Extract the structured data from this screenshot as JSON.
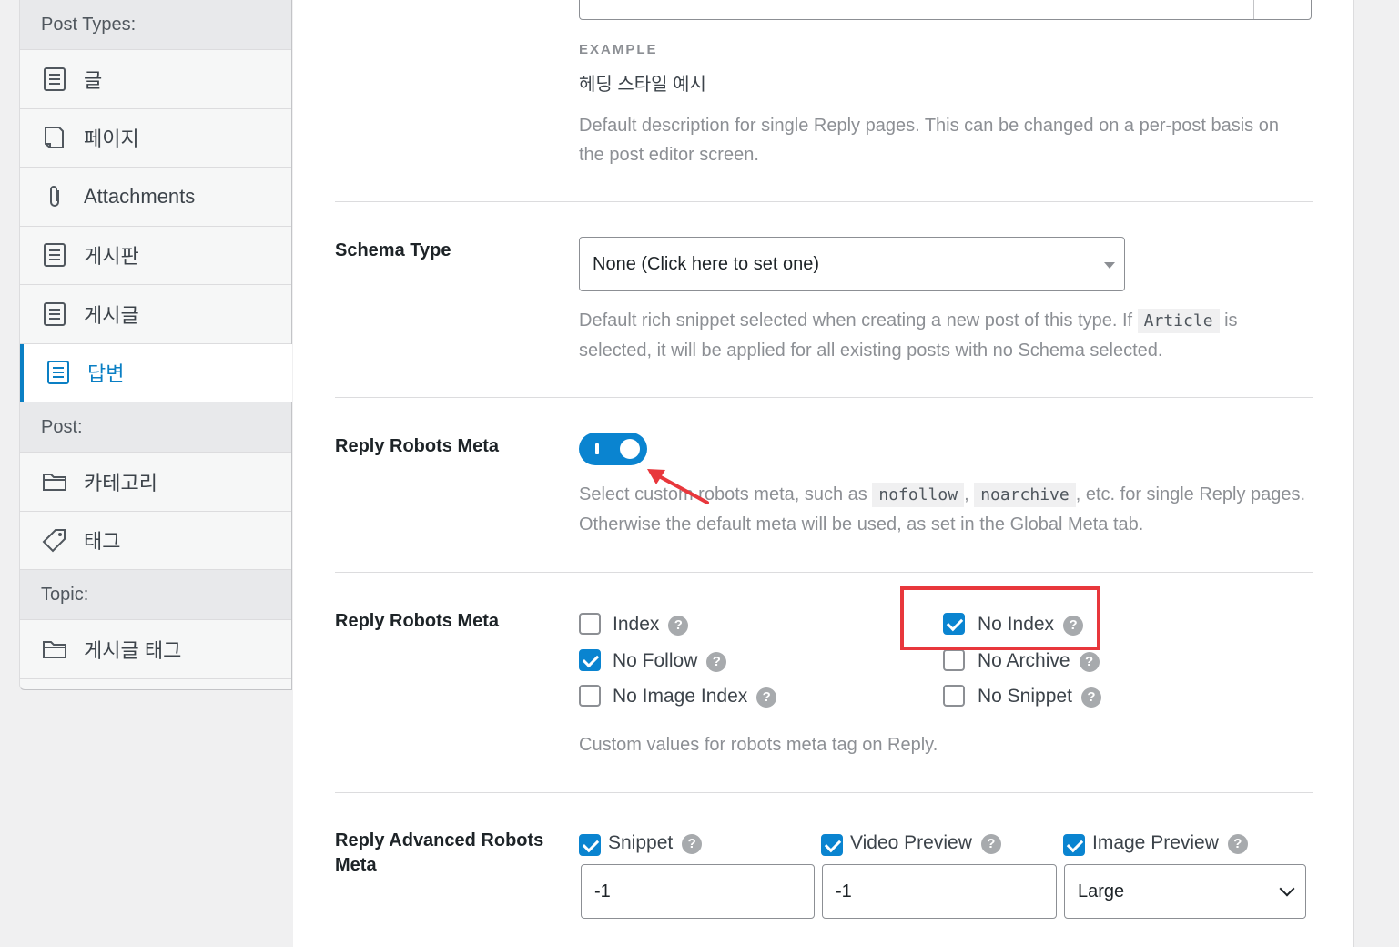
{
  "sidebar": {
    "post_types_heading": "Post Types:",
    "post_types": [
      {
        "label": "글",
        "icon": "document-icon"
      },
      {
        "label": "페이지",
        "icon": "page-icon"
      },
      {
        "label": "Attachments",
        "icon": "paperclip-icon"
      },
      {
        "label": "게시판",
        "icon": "document-icon"
      },
      {
        "label": "게시글",
        "icon": "document-icon"
      },
      {
        "label": "답변",
        "icon": "document-icon",
        "active": true
      }
    ],
    "post_heading": "Post:",
    "post_items": [
      {
        "label": "카테고리",
        "icon": "folder-icon"
      },
      {
        "label": "태그",
        "icon": "tag-icon"
      }
    ],
    "topic_heading": "Topic:",
    "topic_items": [
      {
        "label": "게시글 태그",
        "icon": "folder-icon"
      }
    ]
  },
  "description_field": {
    "example_heading": "EXAMPLE",
    "example_text": "헤딩 스타일 예시",
    "help": "Default description for single Reply pages. This can be changed on a per-post basis on the post editor screen."
  },
  "schema_type": {
    "label": "Schema Type",
    "selected": "None (Click here to set one)",
    "help_before": "Default rich snippet selected when creating a new post of this type. If ",
    "help_code": "Article",
    "help_after": " is selected, it will be applied for all existing posts with no Schema selected."
  },
  "robots_toggle": {
    "label": "Reply Robots Meta",
    "enabled": true,
    "help_1": "Select custom robots meta, such as ",
    "code_1": "nofollow",
    "sep": ",",
    "code_2": "noarchive",
    "help_2": ", etc. for single Reply pages. Otherwise the default meta will be used, as set in the Global Meta tab."
  },
  "robots_meta": {
    "label": "Reply Robots Meta",
    "options": [
      {
        "label": "Index",
        "checked": false
      },
      {
        "label": "No Index",
        "checked": true
      },
      {
        "label": "No Follow",
        "checked": true
      },
      {
        "label": "No Archive",
        "checked": false
      },
      {
        "label": "No Image Index",
        "checked": false
      },
      {
        "label": "No Snippet",
        "checked": false
      }
    ],
    "help": "Custom values for robots meta tag on Reply.",
    "help_glyph": "?"
  },
  "advanced_robots": {
    "label": "Reply Advanced Robots Meta",
    "snippet_label": "Snippet",
    "snippet_value": "-1",
    "video_label": "Video Preview",
    "video_value": "-1",
    "image_label": "Image Preview",
    "image_value": "Large"
  },
  "colors": {
    "accent": "#0a84d0",
    "highlight": "#e8373c"
  }
}
